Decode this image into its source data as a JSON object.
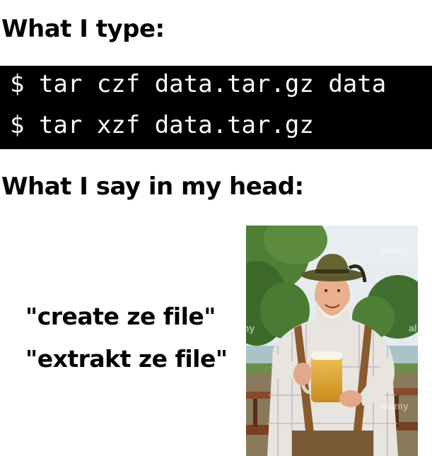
{
  "meme": {
    "heading_type": "What I type:",
    "terminal": [
      "$ tar czf data.tar.gz data",
      "$ tar xzf data.tar.gz"
    ],
    "heading_head": "What I say in my head:",
    "quotes": [
      "\"create ze file\"",
      "\"extrakt ze file\""
    ],
    "photo": {
      "watermarks": [
        "alamy",
        "alamy",
        "alamy"
      ]
    }
  }
}
